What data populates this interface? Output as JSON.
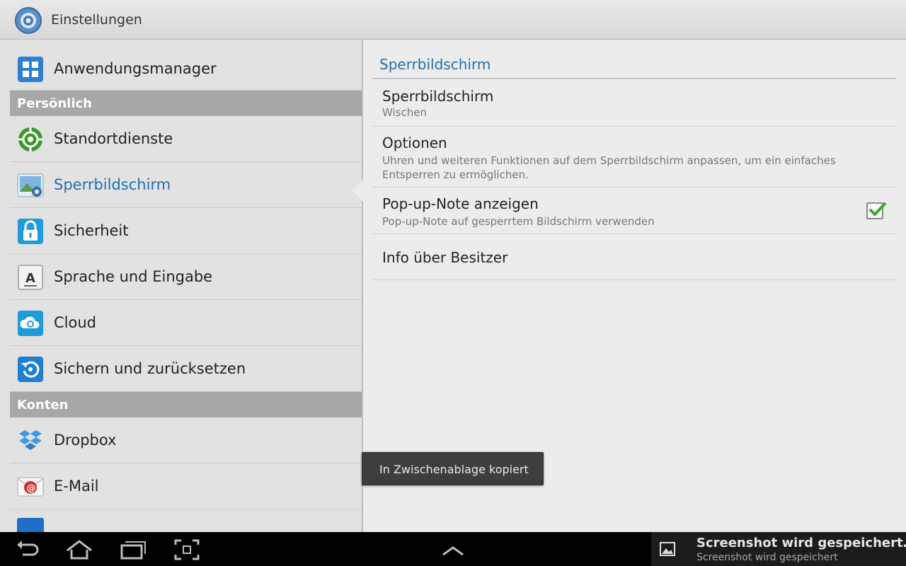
{
  "actionbar": {
    "title": "Einstellungen",
    "icon": "settings-gear-icon"
  },
  "sidebar": {
    "top_item": {
      "label": "Anwendungsmanager",
      "icon": "apps-grid-icon"
    },
    "sections": [
      {
        "header": "Persönlich",
        "items": [
          {
            "label": "Standortdienste",
            "icon": "location-target-icon"
          },
          {
            "label": "Sperrbildschirm",
            "icon": "lockscreen-image-icon",
            "selected": true
          },
          {
            "label": "Sicherheit",
            "icon": "padlock-icon"
          },
          {
            "label": "Sprache und Eingabe",
            "icon": "keyboard-letter-a-icon"
          },
          {
            "label": "Cloud",
            "icon": "cloud-sync-icon"
          },
          {
            "label": "Sichern und zurücksetzen",
            "icon": "backup-restore-icon"
          }
        ]
      },
      {
        "header": "Konten",
        "items": [
          {
            "label": "Dropbox",
            "icon": "dropbox-icon"
          },
          {
            "label": "E-Mail",
            "icon": "email-envelope-icon"
          }
        ]
      }
    ]
  },
  "detail": {
    "header": "Sperrbildschirm",
    "prefs": [
      {
        "title": "Sperrbildschirm",
        "summary": "Wischen"
      },
      {
        "title": "Optionen",
        "summary": "Uhren und weiteren Funktionen auf dem Sperrbildschirm anpassen, um ein einfaches Entsperren zu ermöglichen."
      },
      {
        "title": "Pop-up-Note anzeigen",
        "summary": "Pop-up-Note auf gesperrtem Bildschirm verwenden",
        "checked": true
      },
      {
        "title": "Info über Besitzer",
        "summary": ""
      }
    ]
  },
  "toast": {
    "text": "In Zwischenablage kopiert"
  },
  "systembar": {
    "buttons": [
      "back-arrow-icon",
      "home-icon",
      "recent-apps-icon",
      "screenshot-capture-icon",
      "chevron-up-icon"
    ],
    "notification": {
      "title": "Screenshot wird gespeichert…",
      "subtitle": "Screenshot wird gespeichert",
      "icon": "gallery-image-icon"
    }
  },
  "colors": {
    "accent": "#2270b0",
    "section_bg": "#a7a7a7",
    "pane_bg": "#e2e2e2"
  }
}
